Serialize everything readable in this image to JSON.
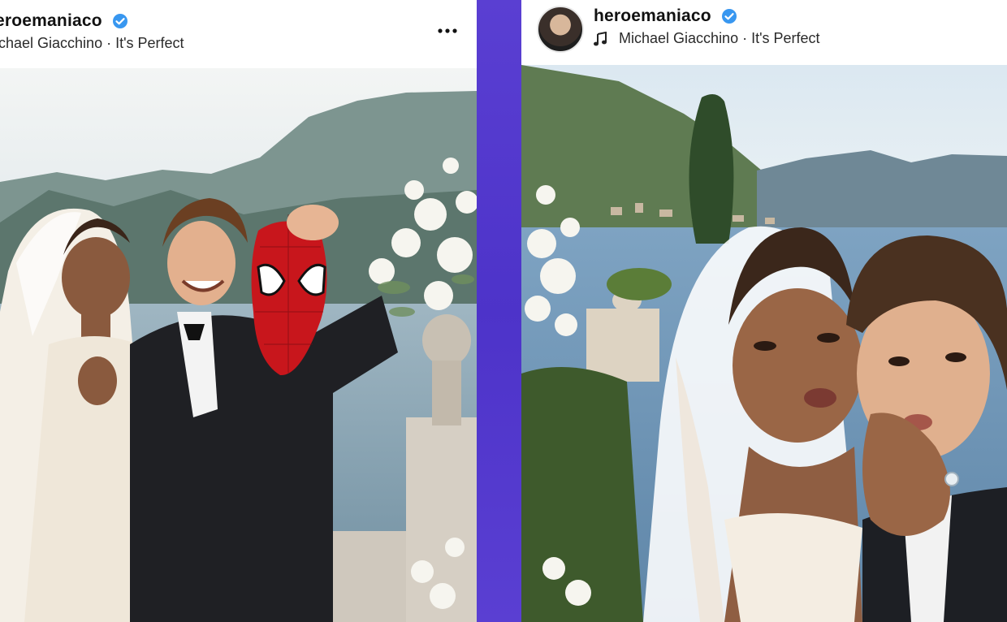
{
  "posts": [
    {
      "username": "eroemaniaco",
      "audio": "Michael Giacchino · It's Perfect",
      "audio_visible": "ichael Giacchino · It's Perfect",
      "verified": true
    },
    {
      "username": "heroemaniaco",
      "audio": "Michael Giacchino · It's Perfect",
      "verified": true
    }
  ],
  "colors": {
    "divider": "#5b3fd4",
    "verified_badge": "#3897f0",
    "lake": "#7fa0b3",
    "sky": "#e9eef0",
    "mountain": "#5f7a72"
  },
  "icons": [
    "verified-badge-icon",
    "music-note-icon",
    "more-options-icon",
    "profile-avatar"
  ]
}
